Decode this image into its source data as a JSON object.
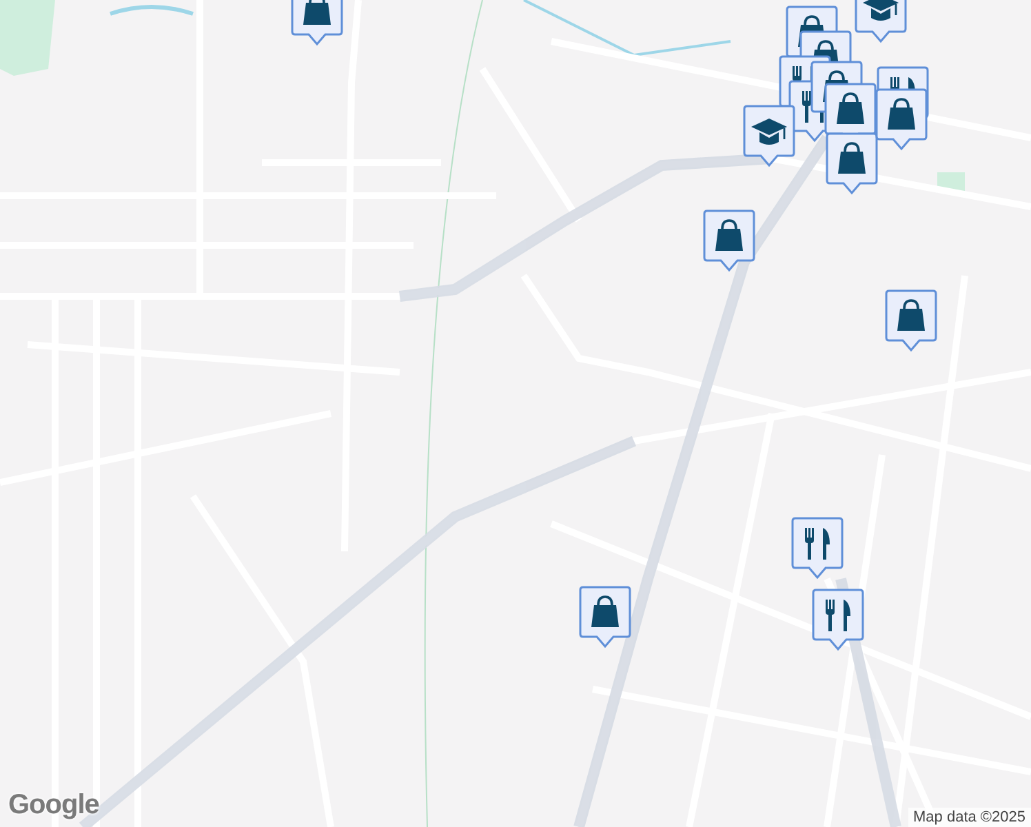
{
  "map": {
    "markers": [
      {
        "kind": "shopping"
      },
      {
        "kind": "school"
      },
      {
        "kind": "shopping"
      },
      {
        "kind": "shopping"
      },
      {
        "kind": "restaurant"
      },
      {
        "kind": "restaurant"
      },
      {
        "kind": "shopping"
      },
      {
        "kind": "restaurant"
      },
      {
        "kind": "shopping"
      },
      {
        "kind": "school"
      },
      {
        "kind": "shopping"
      },
      {
        "kind": "shopping"
      },
      {
        "kind": "shopping"
      },
      {
        "kind": "shopping"
      },
      {
        "kind": "restaurant"
      },
      {
        "kind": "shopping"
      },
      {
        "kind": "restaurant"
      }
    ]
  },
  "logo": "Google",
  "attribution": "Map data ©2025"
}
